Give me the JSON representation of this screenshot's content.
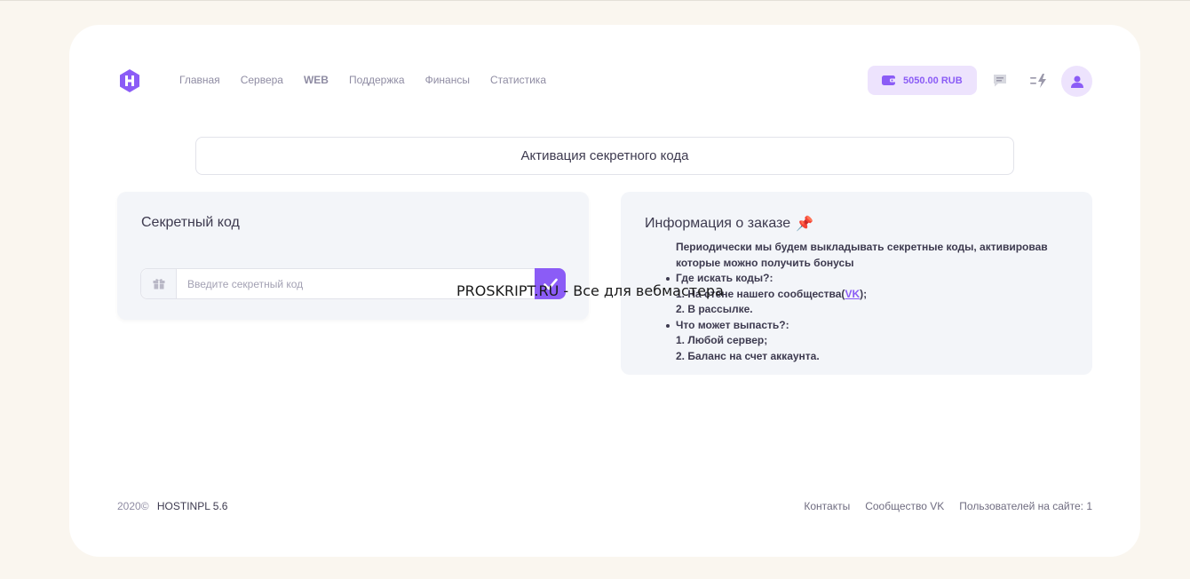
{
  "header": {
    "nav": [
      {
        "label": "Главная",
        "bold": false
      },
      {
        "label": "Сервера",
        "bold": false
      },
      {
        "label": "WEB",
        "bold": true
      },
      {
        "label": "Поддержка",
        "bold": false
      },
      {
        "label": "Финансы",
        "bold": false
      },
      {
        "label": "Статистика",
        "bold": false
      }
    ],
    "balance": "5050.00 RUB",
    "icons": [
      "logo-h-icon",
      "wallet-icon",
      "message-icon",
      "lightning-icon",
      "user-icon"
    ]
  },
  "page_title": "Активация секретного кода",
  "secret_panel": {
    "title": "Секретный код",
    "input_placeholder": "Введите секретный код",
    "input_value": ""
  },
  "info_panel": {
    "title": "Информация о заказе",
    "emoji": "📌",
    "intro": "Периодически мы будем выкладывать секретные коды, активировав которые можно получить бонусы",
    "q1": "Где искать коды?:",
    "q1_a1_prefix": "1. На стене нашего сообщества(",
    "q1_a1_link": "VK",
    "q1_a1_suffix": ");",
    "q1_a2": "2. В рассылке.",
    "q2": "Что может выпасть?:",
    "q2_a1": "1. Любой сервер;",
    "q2_a2": "2. Баланс на счет аккаунта."
  },
  "watermark": "PROSKRIPT.RU - Все для вебмастера",
  "footer": {
    "year": "2020©",
    "brand": "HOSTINPL 5.6",
    "links": [
      "Контакты",
      "Сообщество VK"
    ],
    "online_label": "Пользователей на сайте: 1"
  },
  "colors": {
    "accent": "#8b5cf6",
    "accent_light": "#ede3fd",
    "panel_bg": "#f3f5f9",
    "page_bg": "#faf6ef"
  }
}
